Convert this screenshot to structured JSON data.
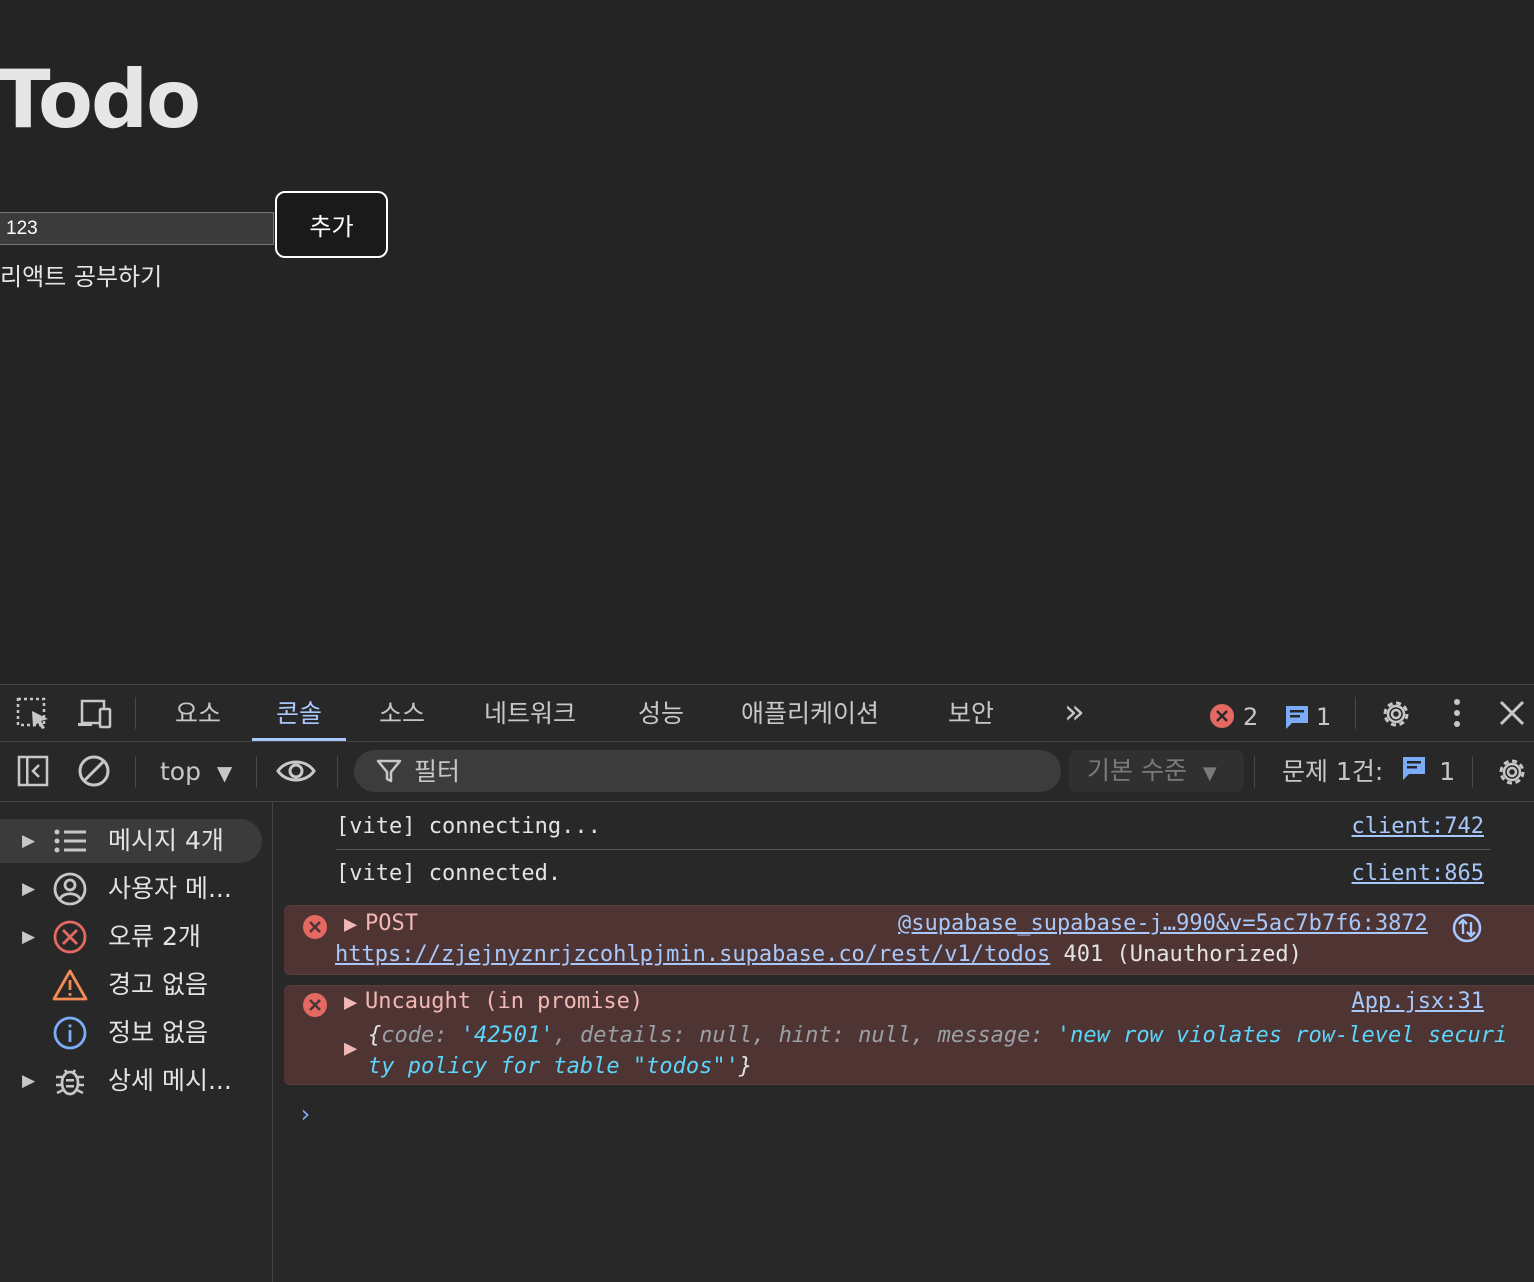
{
  "page": {
    "title": "Todo",
    "input_value": "123",
    "add_button_label": "추가",
    "todos": [
      "리액트 공부하기"
    ]
  },
  "devtools": {
    "tabs": [
      {
        "label": "요소",
        "active": false
      },
      {
        "label": "콘솔",
        "active": true
      },
      {
        "label": "소스",
        "active": false
      },
      {
        "label": "네트워크",
        "active": false
      },
      {
        "label": "성능",
        "active": false
      },
      {
        "label": "애플리케이션",
        "active": false
      },
      {
        "label": "보안",
        "active": false
      }
    ],
    "more_tabs_glyph": "»",
    "error_count": "2",
    "message_count": "1",
    "toolbar": {
      "context": "top",
      "filter_placeholder": "필터",
      "level": "기본 수준",
      "issues_label": "문제 1건:",
      "issues_count": "1"
    },
    "sidebar": [
      {
        "label": "메시지 4개",
        "icon": "list-icon",
        "expandable": true,
        "selected": true
      },
      {
        "label": "사용자 메...",
        "icon": "user-icon",
        "expandable": true,
        "selected": false
      },
      {
        "label": "오류 2개",
        "icon": "error-icon",
        "expandable": true,
        "selected": false
      },
      {
        "label": "경고 없음",
        "icon": "warning-icon",
        "expandable": false,
        "selected": false
      },
      {
        "label": "정보 없음",
        "icon": "info-icon",
        "expandable": false,
        "selected": false
      },
      {
        "label": "상세 메시...",
        "icon": "bug-icon",
        "expandable": true,
        "selected": false
      }
    ],
    "console": {
      "messages": [
        {
          "text": "[vite] connecting...",
          "source": "client:742"
        },
        {
          "text": "[vite] connected.",
          "source": "client:865"
        }
      ],
      "errors": [
        {
          "head": "POST",
          "source": "@supabase_supabase-j…990&v=5ac7b7f6:3872",
          "url": "https://zjejnyznrjzcohlpjmin.supabase.co/rest/v1/todos",
          "status": "401 (Unauthorized)"
        },
        {
          "head": "Uncaught (in promise)",
          "source": "App.jsx:31",
          "obj": {
            "code_key": "code",
            "code_val": "'42501'",
            "details_key": "details",
            "details_val": "null",
            "hint_key": "hint",
            "hint_val": "null",
            "message_key": "message",
            "message_val_1": "'new row violates row-level securi",
            "message_val_2": "ty policy for table \"todos\"'"
          }
        }
      ]
    },
    "colors": {
      "accent": "#a8c7fa",
      "error_bg": "#4e3534",
      "error_red": "#e46962",
      "warning": "#f28b54"
    }
  }
}
